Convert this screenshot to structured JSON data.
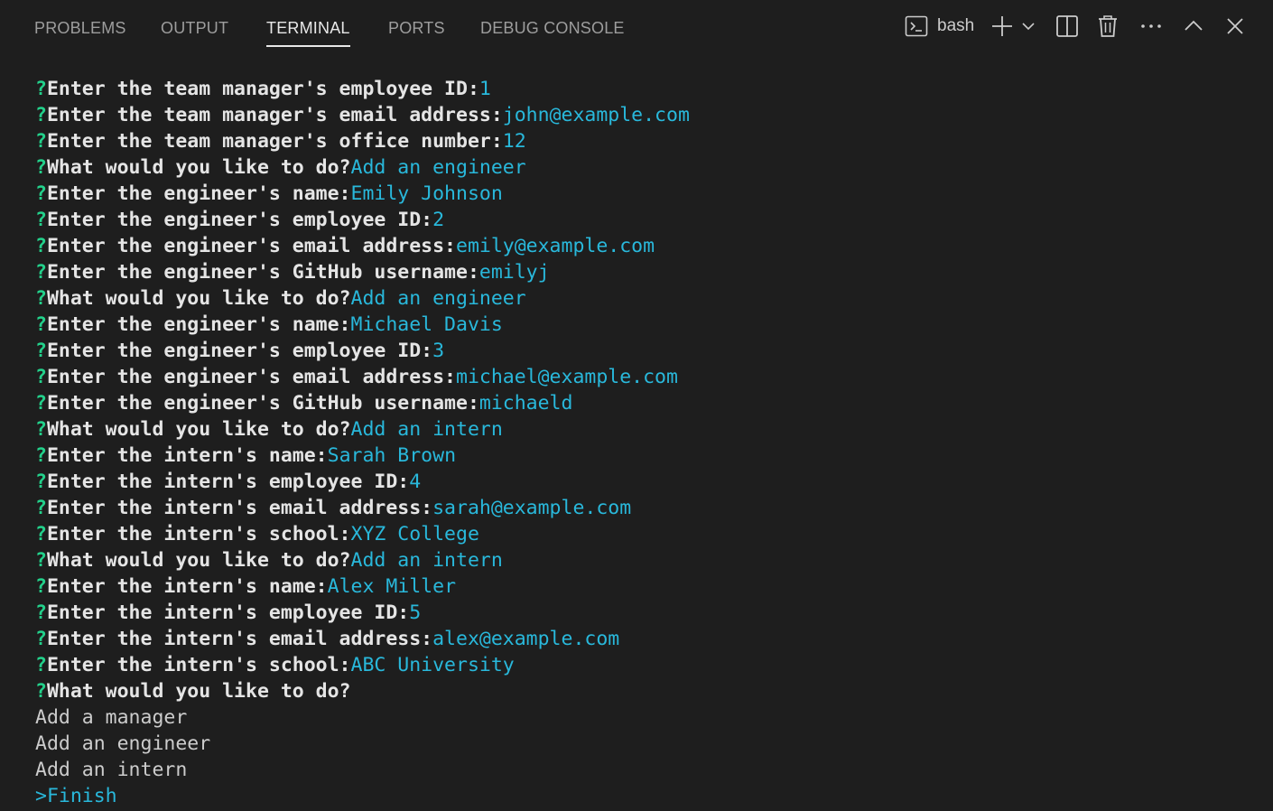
{
  "tabs": [
    {
      "label": "PROBLEMS"
    },
    {
      "label": "OUTPUT"
    },
    {
      "label": "TERMINAL"
    },
    {
      "label": "PORTS"
    },
    {
      "label": "DEBUG CONSOLE"
    }
  ],
  "active_tab": "TERMINAL",
  "toolbar": {
    "terminal_name": "bash",
    "icons": [
      "terminal-icon",
      "plus-icon",
      "chevron-down-icon",
      "split-icon",
      "trash-icon",
      "more-icon",
      "chevron-up-icon",
      "close-icon"
    ]
  },
  "colors": {
    "background": "#1e1e1e",
    "question_mark": "#23d18b",
    "answer": "#29b8db",
    "text": "#cccccc"
  },
  "terminal": {
    "question_mark": "?",
    "pointer": ">",
    "qa": [
      {
        "prompt": "Enter the team manager's employee ID:",
        "answer": "1"
      },
      {
        "prompt": "Enter the team manager's email address:",
        "answer": "john@example.com"
      },
      {
        "prompt": "Enter the team manager's office number:",
        "answer": "12"
      },
      {
        "prompt": "What would you like to do?",
        "answer": "Add an engineer"
      },
      {
        "prompt": "Enter the engineer's name:",
        "answer": "Emily Johnson"
      },
      {
        "prompt": "Enter the engineer's employee ID:",
        "answer": "2"
      },
      {
        "prompt": "Enter the engineer's email address:",
        "answer": "emily@example.com"
      },
      {
        "prompt": "Enter the engineer's GitHub username:",
        "answer": "emilyj"
      },
      {
        "prompt": "What would you like to do?",
        "answer": "Add an engineer"
      },
      {
        "prompt": "Enter the engineer's name:",
        "answer": "Michael Davis"
      },
      {
        "prompt": "Enter the engineer's employee ID:",
        "answer": "3"
      },
      {
        "prompt": "Enter the engineer's email address:",
        "answer": "michael@example.com"
      },
      {
        "prompt": "Enter the engineer's GitHub username:",
        "answer": "michaeld"
      },
      {
        "prompt": "What would you like to do?",
        "answer": "Add an intern"
      },
      {
        "prompt": "Enter the intern's name:",
        "answer": "Sarah Brown"
      },
      {
        "prompt": "Enter the intern's employee ID:",
        "answer": "4"
      },
      {
        "prompt": "Enter the intern's email address:",
        "answer": "sarah@example.com"
      },
      {
        "prompt": "Enter the intern's school:",
        "answer": "XYZ College"
      },
      {
        "prompt": "What would you like to do?",
        "answer": "Add an intern"
      },
      {
        "prompt": "Enter the intern's name:",
        "answer": "Alex Miller"
      },
      {
        "prompt": "Enter the intern's employee ID:",
        "answer": "5"
      },
      {
        "prompt": "Enter the intern's email address:",
        "answer": "alex@example.com"
      },
      {
        "prompt": "Enter the intern's school:",
        "answer": "ABC University"
      }
    ],
    "current_prompt": "What would you like to do?",
    "choices": [
      "Add a manager",
      "Add an engineer",
      "Add an intern"
    ],
    "selected_choice": "Finish"
  }
}
